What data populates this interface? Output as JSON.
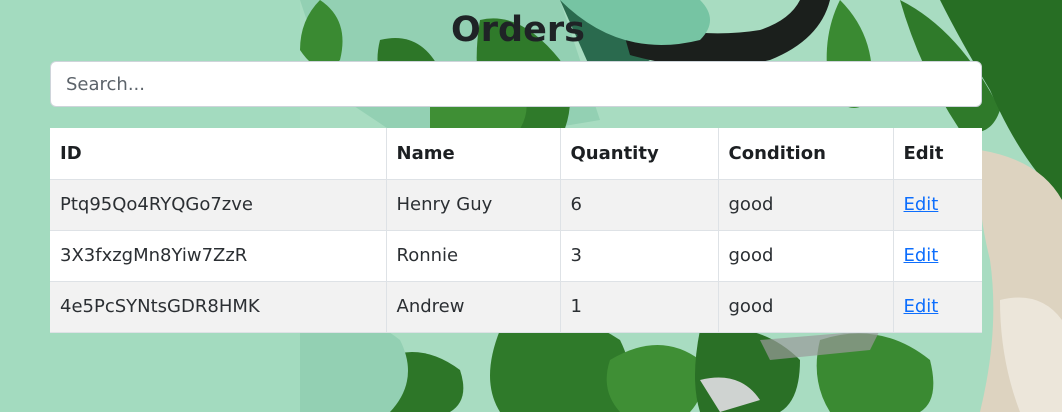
{
  "page": {
    "title": "Orders"
  },
  "search": {
    "placeholder": "Search..."
  },
  "table": {
    "headers": {
      "id": "ID",
      "name": "Name",
      "quantity": "Quantity",
      "condition": "Condition",
      "edit": "Edit"
    },
    "rows": [
      {
        "id": "Ptq95Qo4RYQGo7zve",
        "name": "Henry Guy",
        "quantity": "6",
        "condition": "good",
        "edit": "Edit"
      },
      {
        "id": "3X3fxzgMn8Yiw7ZzR",
        "name": "Ronnie",
        "quantity": "3",
        "condition": "good",
        "edit": "Edit"
      },
      {
        "id": "4e5PcSYNtsGDR8HMK",
        "name": "Andrew",
        "quantity": "1",
        "condition": "good",
        "edit": "Edit"
      }
    ]
  },
  "colors": {
    "background_mint": "#a6dcc0",
    "leaf_green": "#2f7a2a",
    "link_blue": "#0d6efd",
    "striped_row": "#f2f2f2"
  }
}
